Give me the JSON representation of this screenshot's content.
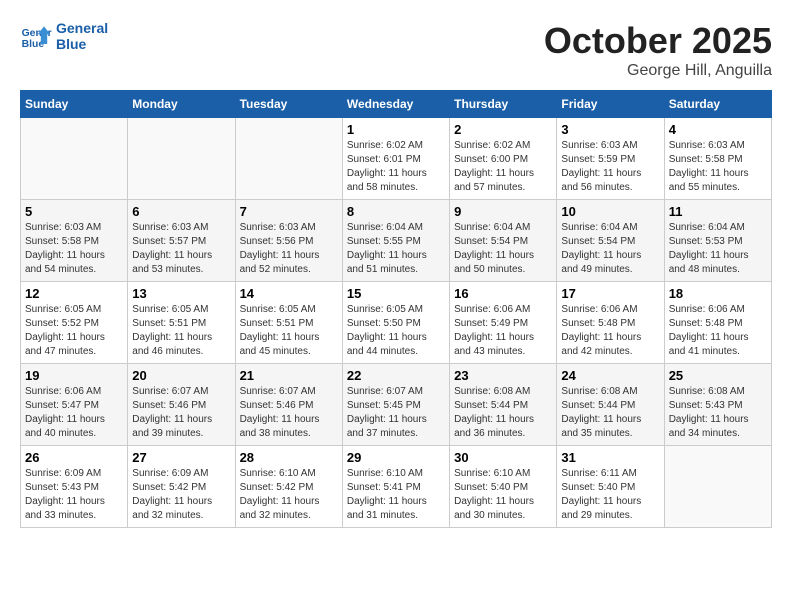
{
  "header": {
    "logo_line1": "General",
    "logo_line2": "Blue",
    "month": "October 2025",
    "location": "George Hill, Anguilla"
  },
  "days_of_week": [
    "Sunday",
    "Monday",
    "Tuesday",
    "Wednesday",
    "Thursday",
    "Friday",
    "Saturday"
  ],
  "weeks": [
    [
      {
        "day": "",
        "info": ""
      },
      {
        "day": "",
        "info": ""
      },
      {
        "day": "",
        "info": ""
      },
      {
        "day": "1",
        "info": "Sunrise: 6:02 AM\nSunset: 6:01 PM\nDaylight: 11 hours\nand 58 minutes."
      },
      {
        "day": "2",
        "info": "Sunrise: 6:02 AM\nSunset: 6:00 PM\nDaylight: 11 hours\nand 57 minutes."
      },
      {
        "day": "3",
        "info": "Sunrise: 6:03 AM\nSunset: 5:59 PM\nDaylight: 11 hours\nand 56 minutes."
      },
      {
        "day": "4",
        "info": "Sunrise: 6:03 AM\nSunset: 5:58 PM\nDaylight: 11 hours\nand 55 minutes."
      }
    ],
    [
      {
        "day": "5",
        "info": "Sunrise: 6:03 AM\nSunset: 5:58 PM\nDaylight: 11 hours\nand 54 minutes."
      },
      {
        "day": "6",
        "info": "Sunrise: 6:03 AM\nSunset: 5:57 PM\nDaylight: 11 hours\nand 53 minutes."
      },
      {
        "day": "7",
        "info": "Sunrise: 6:03 AM\nSunset: 5:56 PM\nDaylight: 11 hours\nand 52 minutes."
      },
      {
        "day": "8",
        "info": "Sunrise: 6:04 AM\nSunset: 5:55 PM\nDaylight: 11 hours\nand 51 minutes."
      },
      {
        "day": "9",
        "info": "Sunrise: 6:04 AM\nSunset: 5:54 PM\nDaylight: 11 hours\nand 50 minutes."
      },
      {
        "day": "10",
        "info": "Sunrise: 6:04 AM\nSunset: 5:54 PM\nDaylight: 11 hours\nand 49 minutes."
      },
      {
        "day": "11",
        "info": "Sunrise: 6:04 AM\nSunset: 5:53 PM\nDaylight: 11 hours\nand 48 minutes."
      }
    ],
    [
      {
        "day": "12",
        "info": "Sunrise: 6:05 AM\nSunset: 5:52 PM\nDaylight: 11 hours\nand 47 minutes."
      },
      {
        "day": "13",
        "info": "Sunrise: 6:05 AM\nSunset: 5:51 PM\nDaylight: 11 hours\nand 46 minutes."
      },
      {
        "day": "14",
        "info": "Sunrise: 6:05 AM\nSunset: 5:51 PM\nDaylight: 11 hours\nand 45 minutes."
      },
      {
        "day": "15",
        "info": "Sunrise: 6:05 AM\nSunset: 5:50 PM\nDaylight: 11 hours\nand 44 minutes."
      },
      {
        "day": "16",
        "info": "Sunrise: 6:06 AM\nSunset: 5:49 PM\nDaylight: 11 hours\nand 43 minutes."
      },
      {
        "day": "17",
        "info": "Sunrise: 6:06 AM\nSunset: 5:48 PM\nDaylight: 11 hours\nand 42 minutes."
      },
      {
        "day": "18",
        "info": "Sunrise: 6:06 AM\nSunset: 5:48 PM\nDaylight: 11 hours\nand 41 minutes."
      }
    ],
    [
      {
        "day": "19",
        "info": "Sunrise: 6:06 AM\nSunset: 5:47 PM\nDaylight: 11 hours\nand 40 minutes."
      },
      {
        "day": "20",
        "info": "Sunrise: 6:07 AM\nSunset: 5:46 PM\nDaylight: 11 hours\nand 39 minutes."
      },
      {
        "day": "21",
        "info": "Sunrise: 6:07 AM\nSunset: 5:46 PM\nDaylight: 11 hours\nand 38 minutes."
      },
      {
        "day": "22",
        "info": "Sunrise: 6:07 AM\nSunset: 5:45 PM\nDaylight: 11 hours\nand 37 minutes."
      },
      {
        "day": "23",
        "info": "Sunrise: 6:08 AM\nSunset: 5:44 PM\nDaylight: 11 hours\nand 36 minutes."
      },
      {
        "day": "24",
        "info": "Sunrise: 6:08 AM\nSunset: 5:44 PM\nDaylight: 11 hours\nand 35 minutes."
      },
      {
        "day": "25",
        "info": "Sunrise: 6:08 AM\nSunset: 5:43 PM\nDaylight: 11 hours\nand 34 minutes."
      }
    ],
    [
      {
        "day": "26",
        "info": "Sunrise: 6:09 AM\nSunset: 5:43 PM\nDaylight: 11 hours\nand 33 minutes."
      },
      {
        "day": "27",
        "info": "Sunrise: 6:09 AM\nSunset: 5:42 PM\nDaylight: 11 hours\nand 32 minutes."
      },
      {
        "day": "28",
        "info": "Sunrise: 6:10 AM\nSunset: 5:42 PM\nDaylight: 11 hours\nand 32 minutes."
      },
      {
        "day": "29",
        "info": "Sunrise: 6:10 AM\nSunset: 5:41 PM\nDaylight: 11 hours\nand 31 minutes."
      },
      {
        "day": "30",
        "info": "Sunrise: 6:10 AM\nSunset: 5:40 PM\nDaylight: 11 hours\nand 30 minutes."
      },
      {
        "day": "31",
        "info": "Sunrise: 6:11 AM\nSunset: 5:40 PM\nDaylight: 11 hours\nand 29 minutes."
      },
      {
        "day": "",
        "info": ""
      }
    ]
  ]
}
